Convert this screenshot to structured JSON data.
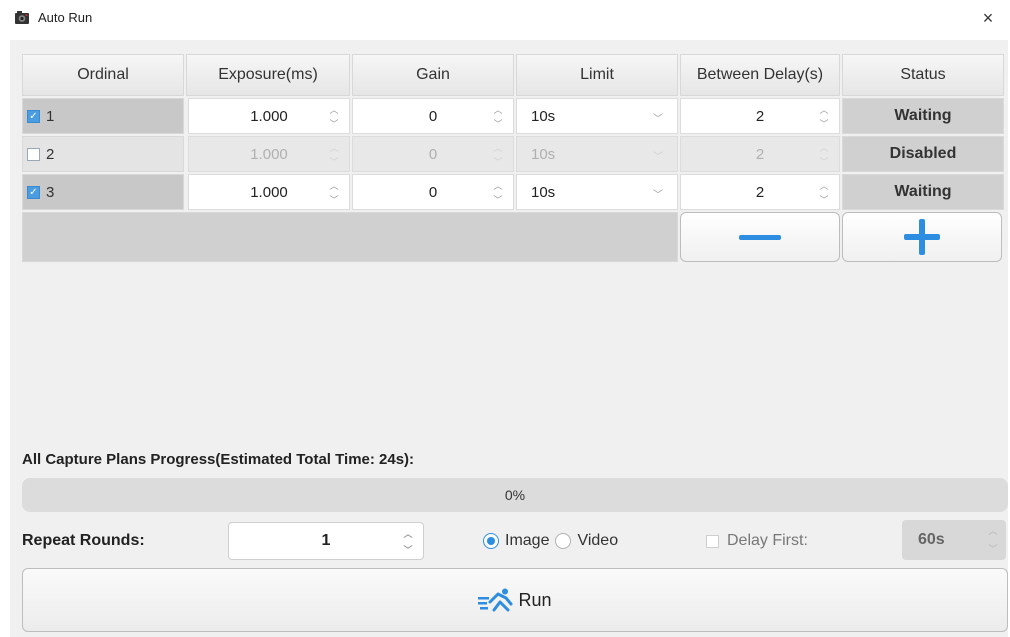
{
  "window": {
    "title": "Auto Run",
    "close_glyph": "×",
    "icon": "camera-app-icon"
  },
  "table": {
    "headers": [
      "Ordinal",
      "Exposure(ms)",
      "Gain",
      "Limit",
      "Between Delay(s)",
      "Status"
    ],
    "rows": [
      {
        "checked": true,
        "ordinal": "1",
        "exposure": "1.000",
        "gain": "0",
        "limit": "10s",
        "delay": "2",
        "status": "Waiting",
        "disabled": false
      },
      {
        "checked": false,
        "ordinal": "2",
        "exposure": "1.000",
        "gain": "0",
        "limit": "10s",
        "delay": "2",
        "status": "Disabled",
        "disabled": true
      },
      {
        "checked": true,
        "ordinal": "3",
        "exposure": "1.000",
        "gain": "0",
        "limit": "10s",
        "delay": "2",
        "status": "Waiting",
        "disabled": false
      }
    ]
  },
  "buttons": {
    "remove_icon": "minus-icon",
    "add_icon": "plus-icon"
  },
  "progress": {
    "label": "All Capture Plans Progress(Estimated Total Time: 24s):",
    "value_percent": 0,
    "text": "0%"
  },
  "repeat": {
    "label": "Repeat Rounds:",
    "value": "1"
  },
  "mode": {
    "options": [
      "Image",
      "Video"
    ],
    "selected": "Image"
  },
  "delay_first": {
    "label": "Delay First:",
    "checked": false,
    "value": "60s"
  },
  "run": {
    "label": "Run",
    "icon": "running-person-icon"
  },
  "colors": {
    "accent": "#2d8de0",
    "background": "#f0f0f0"
  }
}
